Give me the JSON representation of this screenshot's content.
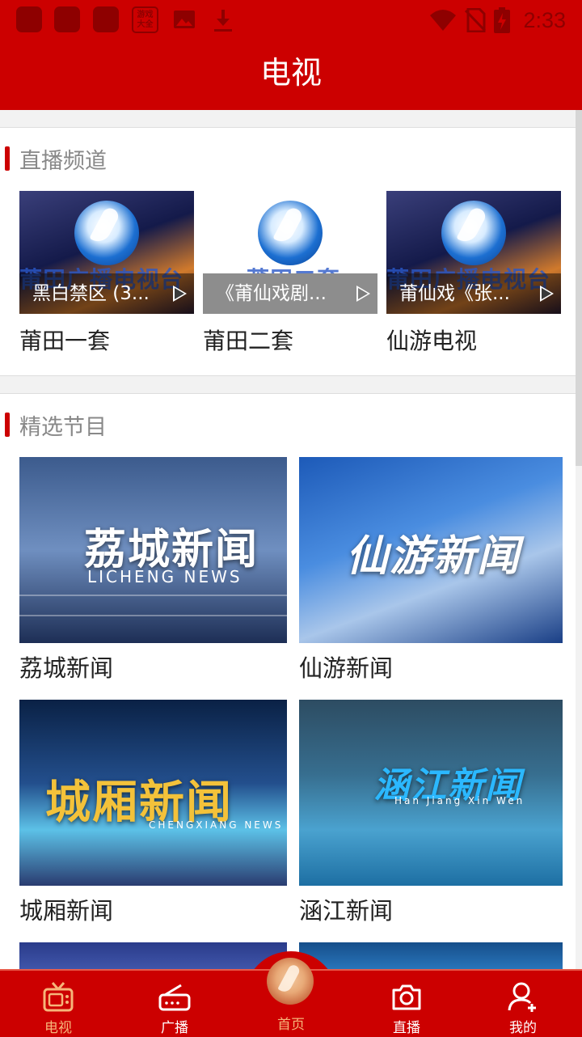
{
  "status_bar": {
    "time": "2:33",
    "game_icon_text": "游戏大全",
    "icons": [
      "notification-square-icon",
      "notification-square-icon",
      "notification-square-icon",
      "game-center-icon",
      "image-icon",
      "download-icon",
      "wifi-icon",
      "no-sim-icon",
      "battery-charging-icon"
    ]
  },
  "header": {
    "title": "电视"
  },
  "live": {
    "section_title": "直播频道",
    "channels": [
      {
        "name": "莆田一套",
        "caption": "黑白禁区 (3...",
        "thumb_text": "莆田广播电视台"
      },
      {
        "name": "莆田二套",
        "caption": "《莆仙戏剧...",
        "thumb_text": "莆田二套"
      },
      {
        "name": "仙游电视",
        "caption": "莆仙戏《张...",
        "thumb_text": "莆田广播电视台"
      }
    ]
  },
  "featured": {
    "section_title": "精选节目",
    "programs": [
      {
        "name": "荔城新闻",
        "overlay_title": "荔城新闻",
        "overlay_sub": "LICHENG  NEWS"
      },
      {
        "name": "仙游新闻",
        "overlay_title": "仙游新闻",
        "overlay_sub": ""
      },
      {
        "name": "城厢新闻",
        "overlay_title": "城厢新闻",
        "overlay_sub": "CHENGXIANG NEWS"
      },
      {
        "name": "涵江新闻",
        "overlay_title": "涵江新闻",
        "overlay_sub": "Han Jiang Xin Wen"
      }
    ]
  },
  "bottom_nav": {
    "items": [
      {
        "label": "电视",
        "icon": "tv-icon",
        "active": true
      },
      {
        "label": "广播",
        "icon": "radio-icon",
        "active": false
      },
      {
        "label": "首页",
        "icon": "home-logo-icon",
        "active": true
      },
      {
        "label": "直播",
        "icon": "camera-icon",
        "active": false
      },
      {
        "label": "我的",
        "icon": "user-add-icon",
        "active": false
      }
    ]
  },
  "colors": {
    "brand_red": "#cc0000",
    "accent_orange": "#f6b57a"
  }
}
